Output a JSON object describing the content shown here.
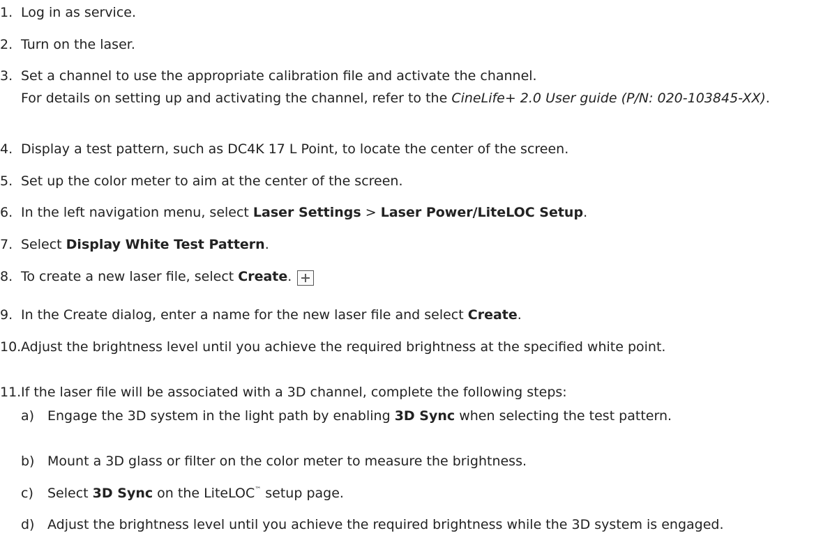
{
  "steps": [
    {
      "num": "1.",
      "text": "Log in as service."
    },
    {
      "num": "2.",
      "text": "Turn on the laser."
    },
    {
      "num": "3.",
      "text": "Set a channel to use the appropriate calibration file and activate the channel.",
      "note_pre": "For details on setting up and activating the channel, refer to the ",
      "note_ref": "CineLife+ 2.0 User guide (P/N: 020-103845-XX)",
      "note_post": "."
    },
    {
      "num": "4.",
      "text": "Display a test pattern, such as DC4K 17 L Point, to locate the center of the screen."
    },
    {
      "num": "5.",
      "text": "Set up the color meter to aim at the center of the screen."
    },
    {
      "num": "6.",
      "pre": "In the left navigation menu, select ",
      "bold1": "Laser Settings",
      "mid": " > ",
      "bold2": "Laser Power/LiteLOC Setup",
      "post": "."
    },
    {
      "num": "7.",
      "pre": "Select ",
      "bold": "Display White Test Pattern",
      "post": "."
    },
    {
      "num": "8.",
      "pre": "To create a new laser file, select ",
      "bold": "Create",
      "post": "."
    },
    {
      "num": "9.",
      "pre": "In the Create dialog, enter a name for the new laser file and select ",
      "bold": "Create",
      "post": "."
    },
    {
      "num": "10.",
      "text": "Adjust the brightness level until you achieve the required brightness at the specified white point."
    },
    {
      "num": "11.",
      "text": "If the laser file will be associated with a 3D channel, complete the following steps:"
    }
  ],
  "substeps": [
    {
      "letter": "a)",
      "pre": "Engage the 3D system in the light path by enabling ",
      "bold": "3D Sync",
      "post": " when selecting the test pattern."
    },
    {
      "letter": "b)",
      "text": "Mount a 3D glass or filter on the color meter to measure the brightness."
    },
    {
      "letter": "c)",
      "pre": "Select ",
      "bold": "3D Sync",
      "mid": " on the LiteLOC",
      "tm": "™",
      "post": " setup page."
    },
    {
      "letter": "d)",
      "text": "Adjust the brightness level until you achieve the required brightness while the 3D system is engaged."
    }
  ],
  "icons": {
    "create": "plus-box-icon"
  }
}
